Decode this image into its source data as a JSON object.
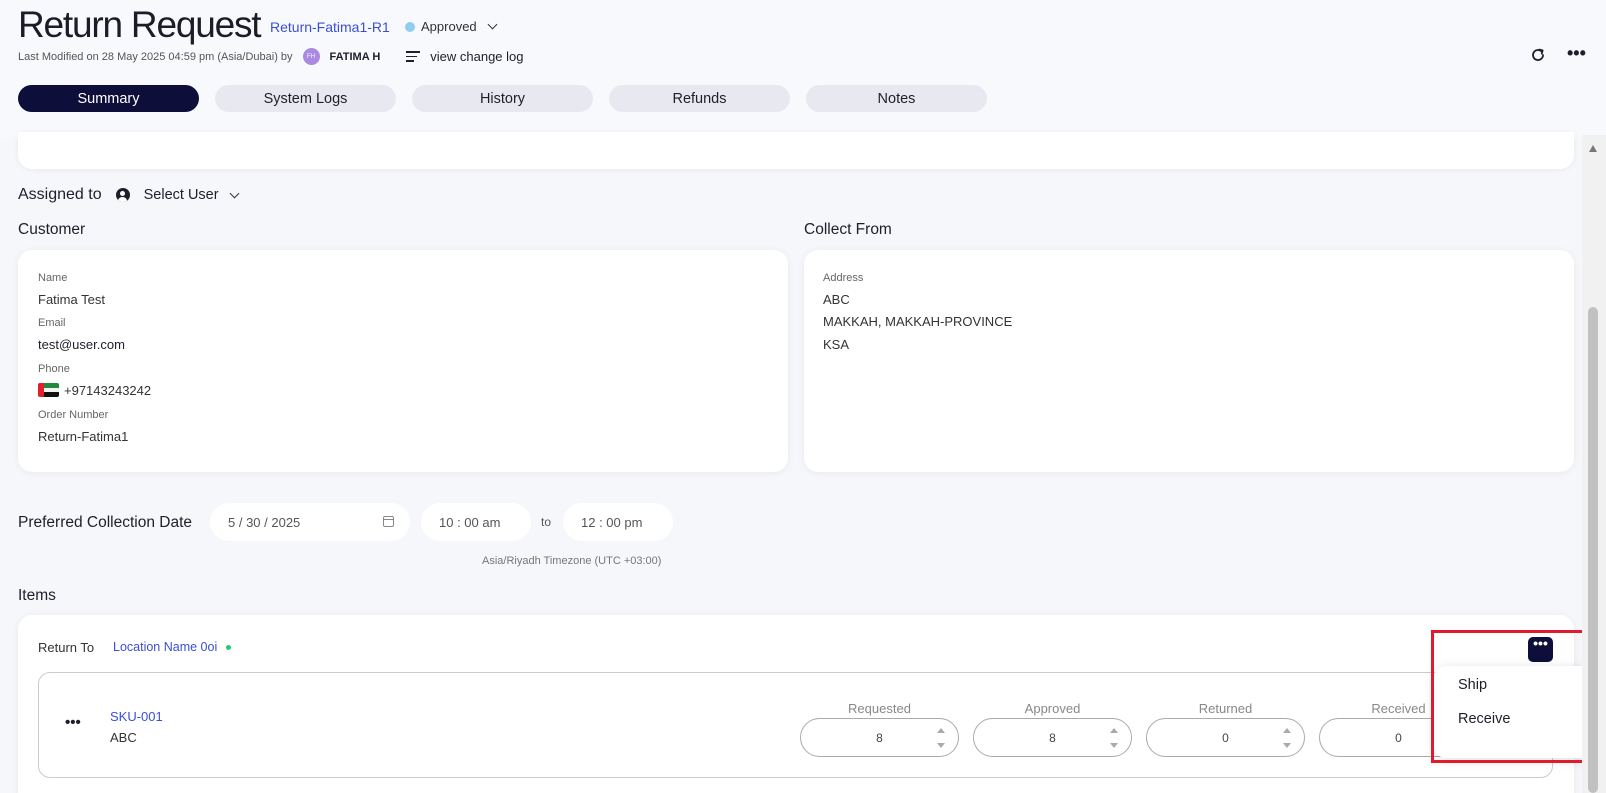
{
  "header": {
    "title": "Return Request",
    "request_id": "Return-Fatima1-R1",
    "status": "Approved",
    "status_color": "#90cdf0",
    "last_modified": "Last Modified on 28 May 2025 04:59 pm (Asia/Dubai) by",
    "user_initials": "FH",
    "user_name": "FATIMA H",
    "change_log": "view change log"
  },
  "tabs": [
    {
      "label": "Summary",
      "active": true
    },
    {
      "label": "System Logs"
    },
    {
      "label": "History"
    },
    {
      "label": "Refunds"
    },
    {
      "label": "Notes"
    }
  ],
  "assigned": {
    "label": "Assigned to",
    "select_label": "Select User"
  },
  "customer": {
    "section_title": "Customer",
    "name_label": "Name",
    "name": "Fatima Test",
    "email_label": "Email",
    "email": "test@user.com",
    "phone_label": "Phone",
    "phone": "+97143243242",
    "order_label": "Order Number",
    "order_number": "Return-Fatima1"
  },
  "collect_from": {
    "section_title": "Collect From",
    "address_label": "Address",
    "line1": "ABC",
    "line2": "MAKKAH, MAKKAH-PROVINCE",
    "line3": "KSA"
  },
  "collection": {
    "label": "Preferred Collection Date",
    "date": "5 / 30 / 2025",
    "time_from": "10 : 00 am",
    "to_label": "to",
    "time_to": "12 : 00 pm",
    "timezone": "Asia/Riyadh Timezone (UTC +03:00)"
  },
  "items": {
    "section_title": "Items",
    "return_to_label": "Return To",
    "location": "Location Name 0oi",
    "rows": [
      {
        "sku": "SKU-001",
        "name": "ABC",
        "requested": "8",
        "approved": "8",
        "returned": "0",
        "received": "0"
      }
    ],
    "columns": {
      "requested": "Requested",
      "approved": "Approved",
      "returned": "Returned",
      "received": "Received"
    }
  },
  "menu": {
    "ship": "Ship",
    "receive": "Receive"
  },
  "colors": {
    "primary_dark": "#0d0f3a",
    "link_blue": "#3a4fd8",
    "highlight_red": "#e21b2c",
    "location_dot": "#29c47a"
  }
}
